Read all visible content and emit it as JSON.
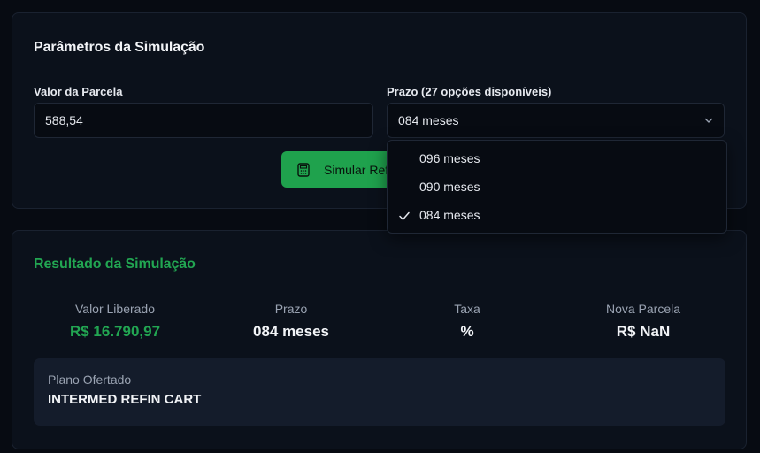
{
  "params": {
    "title": "Parâmetros da Simulação",
    "valor_label": "Valor da Parcela",
    "valor_value": "588,54",
    "prazo_label": "Prazo (27 opções disponíveis)",
    "prazo_selected": "084 meses",
    "button_label": "Simular Refi",
    "dropdown_options": [
      {
        "label": "096 meses",
        "selected": false
      },
      {
        "label": "090 meses",
        "selected": false
      },
      {
        "label": "084 meses",
        "selected": true
      }
    ]
  },
  "result": {
    "title": "Resultado da Simulação",
    "stats": [
      {
        "label": "Valor Liberado",
        "value": "R$ 16.790,97"
      },
      {
        "label": "Prazo",
        "value": "084 meses"
      },
      {
        "label": "Taxa",
        "value": "%"
      },
      {
        "label": "Nova Parcela",
        "value": "R$ NaN"
      }
    ],
    "plan_label": "Plano Ofertado",
    "plan_value": "INTERMED REFIN CART"
  },
  "colors": {
    "accent_green": "#22a652",
    "button_green": "#1fa24d",
    "background": "#070b12",
    "card": "#0b111b"
  }
}
